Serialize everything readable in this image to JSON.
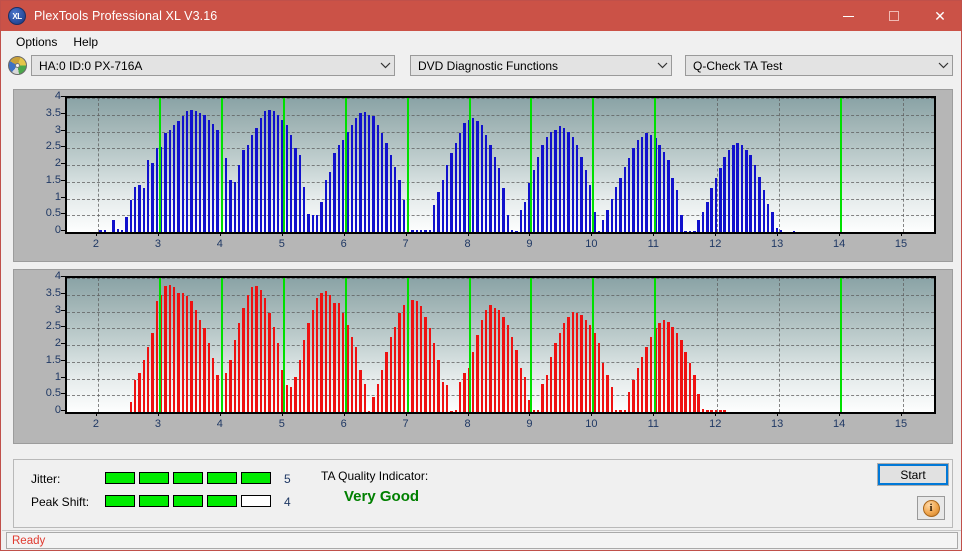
{
  "window": {
    "title": "PlexTools Professional XL V3.16",
    "icon": "xl-logo-icon",
    "controls": {
      "minimize": "–",
      "maximize": "□",
      "close": "✕"
    },
    "titlebar_color": "#cb5247"
  },
  "menu": {
    "items": [
      "Options",
      "Help"
    ]
  },
  "toolbar": {
    "drive_icon": "optical-disc-icon",
    "drive_select": {
      "value": "HA:0 ID:0  PX-716A",
      "chevron": "∨"
    },
    "function_select": {
      "value": "DVD Diagnostic Functions",
      "chevron": "∨"
    },
    "test_select": {
      "value": "Q-Check TA Test",
      "chevron": "∨"
    }
  },
  "results": {
    "jitter_label": "Jitter:",
    "jitter_value": "5",
    "jitter_segments": [
      true,
      true,
      true,
      true,
      true
    ],
    "peak_shift_label": "Peak Shift:",
    "peak_shift_value": "4",
    "peak_shift_segments": [
      true,
      true,
      true,
      true,
      false
    ],
    "ta_quality_label": "TA Quality Indicator:",
    "ta_quality_value": "Very Good",
    "ta_quality_color": "#008000",
    "start_label": "Start",
    "info_icon": "info-icon",
    "info_glyph": "i"
  },
  "statusbar": {
    "text": "Ready",
    "color": "#e03a2f"
  },
  "chart_data": [
    {
      "id": "jitter",
      "type": "bar",
      "title": "Jitter",
      "color": "#1111cc",
      "xlabel": "",
      "ylabel": "",
      "ylim": [
        0,
        4
      ],
      "xlim": [
        1.5,
        15.5
      ],
      "yticks": [
        0,
        0.5,
        1,
        1.5,
        2,
        2.5,
        3,
        3.5,
        4
      ],
      "ytick_labels": [
        "0",
        "0.5",
        "1",
        "1.5",
        "2",
        "2.5",
        "3",
        "3.5",
        "4"
      ],
      "xticks": [
        2,
        3,
        4,
        5,
        6,
        7,
        8,
        9,
        10,
        11,
        12,
        13,
        14,
        15
      ],
      "xtick_labels": [
        "2",
        "3",
        "4",
        "5",
        "6",
        "7",
        "8",
        "9",
        "10",
        "11",
        "12",
        "13",
        "14",
        "15"
      ],
      "grid": true,
      "markers": [
        3,
        4,
        5,
        6,
        7,
        8,
        9,
        10,
        11,
        14
      ],
      "marker_color": "#00e000",
      "x": [
        1.55,
        1.62,
        1.69,
        1.76,
        1.83,
        1.9,
        1.97,
        2.04,
        2.11,
        2.18,
        2.25,
        2.32,
        2.39,
        2.46,
        2.53,
        2.6,
        2.67,
        2.74,
        2.81,
        2.88,
        2.95,
        3.02,
        3.09,
        3.16,
        3.23,
        3.3,
        3.37,
        3.44,
        3.51,
        3.58,
        3.65,
        3.72,
        3.79,
        3.86,
        3.93,
        4.0,
        4.07,
        4.14,
        4.21,
        4.28,
        4.35,
        4.42,
        4.49,
        4.56,
        4.63,
        4.7,
        4.77,
        4.84,
        4.91,
        4.98,
        5.05,
        5.12,
        5.19,
        5.26,
        5.33,
        5.4,
        5.47,
        5.54,
        5.61,
        5.68,
        5.75,
        5.82,
        5.89,
        5.96,
        6.03,
        6.1,
        6.17,
        6.24,
        6.31,
        6.38,
        6.45,
        6.52,
        6.59,
        6.66,
        6.73,
        6.8,
        6.87,
        6.94,
        7.01,
        7.08,
        7.15,
        7.22,
        7.29,
        7.36,
        7.43,
        7.5,
        7.57,
        7.64,
        7.71,
        7.78,
        7.85,
        7.92,
        7.99,
        8.06,
        8.13,
        8.2,
        8.27,
        8.34,
        8.41,
        8.48,
        8.55,
        8.62,
        8.69,
        8.76,
        8.83,
        8.9,
        8.97,
        9.04,
        9.11,
        9.18,
        9.25,
        9.32,
        9.39,
        9.46,
        9.53,
        9.6,
        9.67,
        9.74,
        9.81,
        9.88,
        9.95,
        10.02,
        10.09,
        10.16,
        10.23,
        10.3,
        10.37,
        10.44,
        10.51,
        10.58,
        10.65,
        10.72,
        10.79,
        10.86,
        10.93,
        11.0,
        11.07,
        11.14,
        11.21,
        11.28,
        11.35,
        11.42,
        11.49,
        11.56,
        11.63,
        11.7,
        11.77,
        11.84,
        11.91,
        11.98,
        12.05,
        12.12,
        12.19,
        12.26,
        12.33,
        12.4,
        12.47,
        12.54,
        12.61,
        12.68,
        12.75,
        12.82,
        12.89,
        12.96,
        13.03,
        13.1,
        13.17,
        13.24,
        13.31,
        13.38,
        13.45,
        13.52,
        13.59,
        13.66,
        13.73,
        13.8,
        13.87,
        13.94,
        14.01,
        14.08,
        14.15,
        14.22,
        14.29,
        14.36,
        14.43,
        14.5,
        14.57,
        14.64,
        14.71,
        14.78,
        14.85,
        14.92,
        14.99,
        15.06,
        15.13,
        15.2,
        15.27,
        15.34,
        15.41,
        15.48
      ],
      "values": [
        0,
        0,
        0,
        0,
        0,
        0,
        0,
        0.06,
        0.05,
        0,
        0.35,
        0.08,
        0.05,
        0.45,
        0.95,
        1.35,
        1.4,
        1.32,
        2.15,
        2.05,
        2.5,
        2.55,
        2.95,
        3.05,
        3.2,
        3.3,
        3.45,
        3.6,
        3.65,
        3.62,
        3.55,
        3.48,
        3.35,
        3.22,
        3.05,
        2.9,
        2.2,
        1.55,
        1.5,
        2.0,
        2.45,
        2.6,
        2.9,
        3.1,
        3.4,
        3.6,
        3.65,
        3.6,
        3.5,
        3.35,
        3.2,
        2.9,
        2.5,
        2.3,
        1.35,
        0.55,
        0.5,
        0.5,
        0.9,
        1.55,
        1.8,
        2.35,
        2.6,
        2.75,
        3.0,
        3.2,
        3.4,
        3.55,
        3.58,
        3.5,
        3.45,
        3.2,
        2.95,
        2.65,
        2.3,
        1.95,
        1.55,
        0.95,
        0.8,
        0.05,
        0.05,
        0.05,
        0.05,
        0.05,
        0.8,
        1.2,
        1.55,
        2.0,
        2.35,
        2.65,
        2.95,
        3.25,
        3.35,
        3.4,
        3.3,
        3.2,
        2.9,
        2.6,
        2.25,
        1.9,
        1.3,
        0.5,
        0.05,
        0.02,
        0.65,
        0.9,
        1.45,
        1.85,
        2.25,
        2.6,
        2.85,
        3.0,
        3.05,
        3.15,
        3.1,
        3.0,
        2.85,
        2.6,
        2.25,
        1.85,
        1.4,
        0.6,
        0.02,
        0.35,
        0.65,
        1.0,
        1.35,
        1.6,
        1.95,
        2.2,
        2.5,
        2.75,
        2.85,
        2.95,
        2.9,
        2.8,
        2.6,
        2.4,
        2.15,
        1.6,
        1.25,
        0.5,
        0.02,
        0.02,
        0.02,
        0.35,
        0.6,
        0.9,
        1.3,
        1.6,
        1.9,
        2.25,
        2.45,
        2.6,
        2.65,
        2.6,
        2.45,
        2.3,
        2.0,
        1.65,
        1.25,
        0.85,
        0.6,
        0.12,
        0.05,
        0.0,
        0.0,
        0.02,
        0.0,
        0.0,
        0.0,
        0.0,
        0.0,
        0.0,
        0.0,
        0.0,
        0.0,
        0.0,
        0.0,
        0.0,
        0.0,
        0.0,
        0.0,
        0.0,
        0.0,
        0.0,
        0.0,
        0.0,
        0.0,
        0.0,
        0.0,
        0.0,
        0.0,
        0.0,
        0.0,
        0.0
      ]
    },
    {
      "id": "peak_shift",
      "type": "bar",
      "title": "Peak Shift",
      "color": "#ee1111",
      "xlabel": "",
      "ylabel": "",
      "ylim": [
        0,
        4
      ],
      "xlim": [
        1.5,
        15.5
      ],
      "yticks": [
        0,
        0.5,
        1,
        1.5,
        2,
        2.5,
        3,
        3.5,
        4
      ],
      "ytick_labels": [
        "0",
        "0.5",
        "1",
        "1.5",
        "2",
        "2.5",
        "3",
        "3.5",
        "4"
      ],
      "xticks": [
        2,
        3,
        4,
        5,
        6,
        7,
        8,
        9,
        10,
        11,
        12,
        13,
        14,
        15
      ],
      "xtick_labels": [
        "2",
        "3",
        "4",
        "5",
        "6",
        "7",
        "8",
        "9",
        "10",
        "11",
        "12",
        "13",
        "14",
        "15"
      ],
      "grid": true,
      "markers": [
        3,
        4,
        5,
        6,
        7,
        8,
        9,
        10,
        11,
        14
      ],
      "marker_color": "#00e000",
      "x": [
        1.55,
        1.62,
        1.69,
        1.76,
        1.83,
        1.9,
        1.97,
        2.04,
        2.11,
        2.18,
        2.25,
        2.32,
        2.39,
        2.46,
        2.53,
        2.6,
        2.67,
        2.74,
        2.81,
        2.88,
        2.95,
        3.02,
        3.09,
        3.16,
        3.23,
        3.3,
        3.37,
        3.44,
        3.51,
        3.58,
        3.65,
        3.72,
        3.79,
        3.86,
        3.93,
        4.0,
        4.07,
        4.14,
        4.21,
        4.28,
        4.35,
        4.42,
        4.49,
        4.56,
        4.63,
        4.7,
        4.77,
        4.84,
        4.91,
        4.98,
        5.05,
        5.12,
        5.19,
        5.26,
        5.33,
        5.4,
        5.47,
        5.54,
        5.61,
        5.68,
        5.75,
        5.82,
        5.89,
        5.96,
        6.03,
        6.1,
        6.17,
        6.24,
        6.31,
        6.38,
        6.45,
        6.52,
        6.59,
        6.66,
        6.73,
        6.8,
        6.87,
        6.94,
        7.01,
        7.08,
        7.15,
        7.22,
        7.29,
        7.36,
        7.43,
        7.5,
        7.57,
        7.64,
        7.71,
        7.78,
        7.85,
        7.92,
        7.99,
        8.06,
        8.13,
        8.2,
        8.27,
        8.34,
        8.41,
        8.48,
        8.55,
        8.62,
        8.69,
        8.76,
        8.83,
        8.9,
        8.97,
        9.04,
        9.11,
        9.18,
        9.25,
        9.32,
        9.39,
        9.46,
        9.53,
        9.6,
        9.67,
        9.74,
        9.81,
        9.88,
        9.95,
        10.02,
        10.09,
        10.16,
        10.23,
        10.3,
        10.37,
        10.44,
        10.51,
        10.58,
        10.65,
        10.72,
        10.79,
        10.86,
        10.93,
        11.0,
        11.07,
        11.14,
        11.21,
        11.28,
        11.35,
        11.42,
        11.49,
        11.56,
        11.63,
        11.7,
        11.77,
        11.84,
        11.91,
        11.98,
        12.05,
        12.12,
        12.19,
        12.26,
        12.33,
        12.4,
        12.47,
        12.54,
        12.61,
        12.68,
        12.75,
        12.82,
        12.89,
        12.96,
        13.03,
        13.1,
        13.17,
        13.24,
        13.31,
        13.38,
        13.45,
        13.52,
        13.59,
        13.66,
        13.73,
        13.8,
        13.87,
        13.94,
        14.01,
        14.08,
        14.15,
        14.22,
        14.29,
        14.36,
        14.43,
        14.5,
        14.57,
        14.64,
        14.71,
        14.78,
        14.85,
        14.92,
        14.99,
        15.06,
        15.13,
        15.2,
        15.27,
        15.34,
        15.41,
        15.48
      ],
      "values": [
        0,
        0,
        0,
        0,
        0,
        0,
        0,
        0,
        0,
        0,
        0,
        0,
        0,
        0,
        0.3,
        0.95,
        1.15,
        1.55,
        1.95,
        2.35,
        3.3,
        3.5,
        3.75,
        3.8,
        3.72,
        3.55,
        3.55,
        3.45,
        3.3,
        3.05,
        2.75,
        2.5,
        2.05,
        1.6,
        1.1,
        1.1,
        1.15,
        1.55,
        2.15,
        2.65,
        3.1,
        3.5,
        3.72,
        3.75,
        3.65,
        3.4,
        2.95,
        2.55,
        2.05,
        1.25,
        0.8,
        0.75,
        1.05,
        1.55,
        2.15,
        2.65,
        3.05,
        3.4,
        3.55,
        3.6,
        3.5,
        3.25,
        3.25,
        2.95,
        2.6,
        2.25,
        1.95,
        1.25,
        0.85,
        0.03,
        0.45,
        0.85,
        1.25,
        1.8,
        2.25,
        2.55,
        2.95,
        3.2,
        3.4,
        3.35,
        3.3,
        3.15,
        2.85,
        2.5,
        2.05,
        1.55,
        0.9,
        0.8,
        0.03,
        0.05,
        0.9,
        1.15,
        1.3,
        1.8,
        2.3,
        2.75,
        3.05,
        3.2,
        3.1,
        3.05,
        2.85,
        2.6,
        2.25,
        1.85,
        1.3,
        1.05,
        0.35,
        0.05,
        0.05,
        0.85,
        1.1,
        1.65,
        2.05,
        2.35,
        2.65,
        2.85,
        3.0,
        2.95,
        2.9,
        2.75,
        2.6,
        2.35,
        2.05,
        1.45,
        1.1,
        0.75,
        0.05,
        0.05,
        0.05,
        0.6,
        0.95,
        1.3,
        1.65,
        1.95,
        2.25,
        2.5,
        2.65,
        2.75,
        2.7,
        2.55,
        2.35,
        2.15,
        1.8,
        1.45,
        1.1,
        0.55,
        0.1,
        0.05,
        0.05,
        0.05,
        0.05,
        0.05,
        0.0,
        0.0,
        0.0,
        0.0,
        0.0,
        0.0,
        0.0,
        0.0,
        0.0,
        0.0,
        0.0,
        0.0,
        0.0,
        0.0,
        0.0,
        0.0,
        0.0,
        0.0,
        0.0,
        0.0,
        0.0,
        0.0,
        0.0,
        0.0,
        0.0,
        0.0,
        0.0,
        0.0,
        0.0,
        0.0,
        0.0,
        0.0,
        0.0,
        0.0,
        0.0,
        0.0,
        0.0,
        0.0,
        0.0,
        0.0,
        0.0,
        0.0
      ]
    }
  ]
}
